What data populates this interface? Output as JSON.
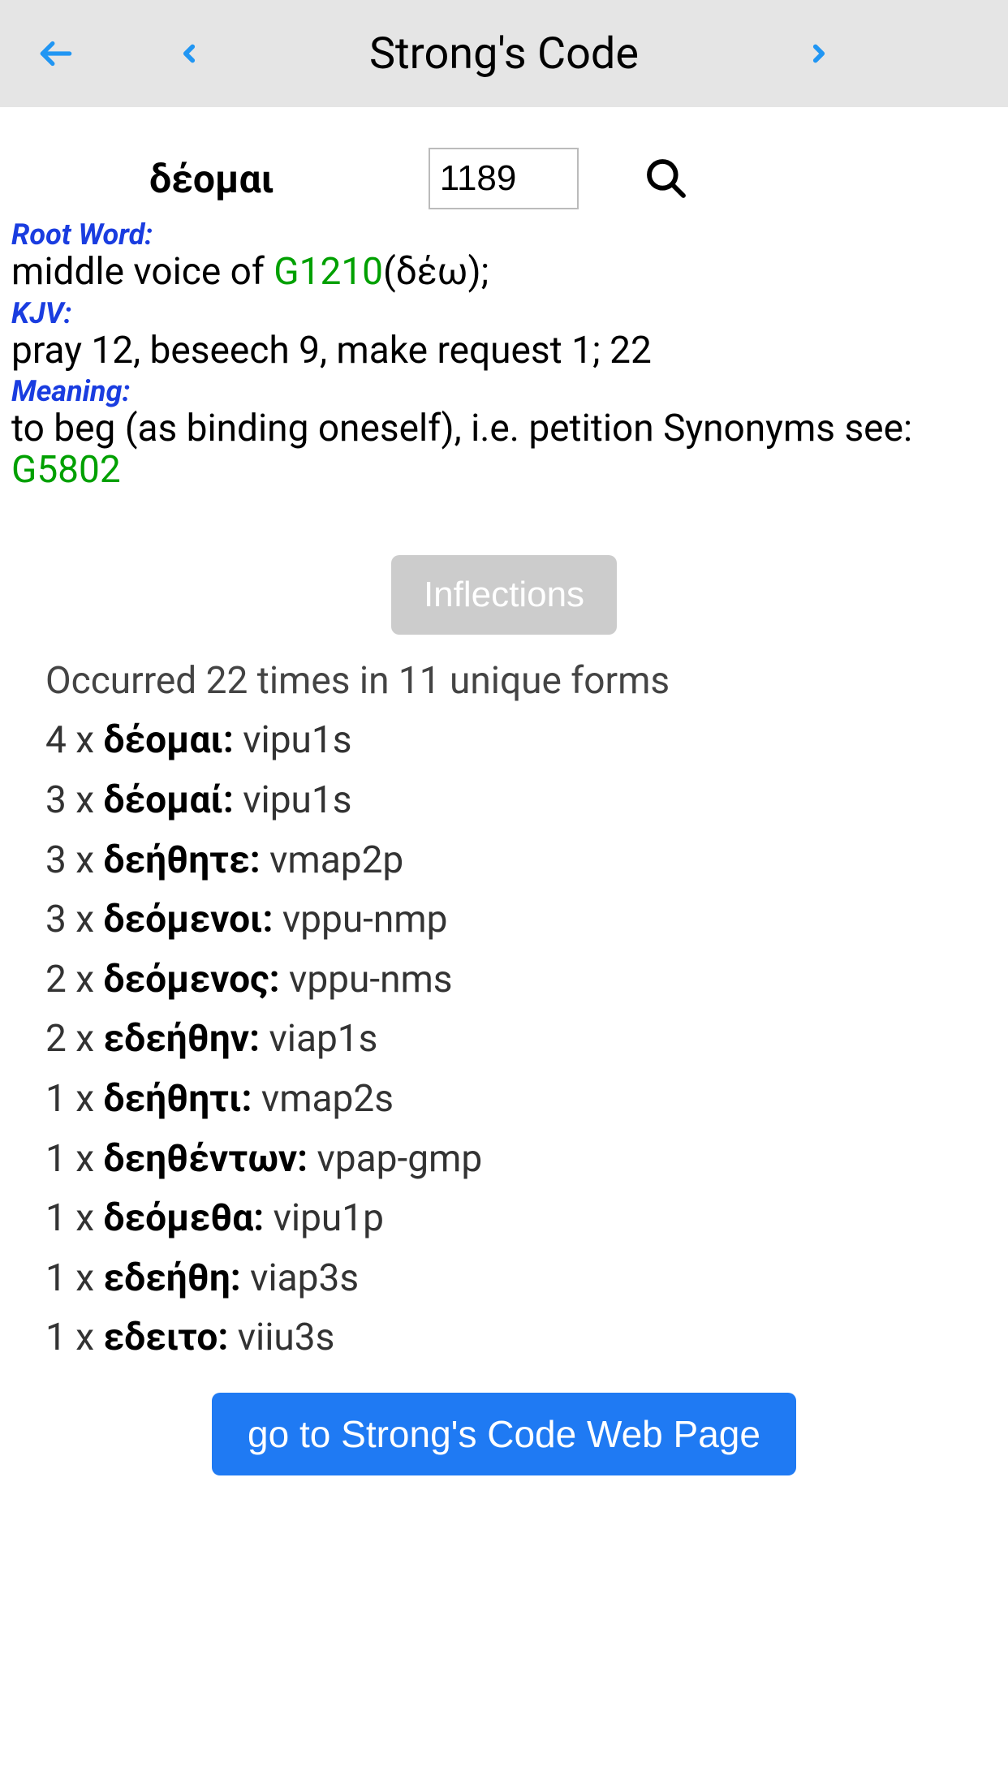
{
  "header": {
    "title": "Strong's Code"
  },
  "word": {
    "greek": "δέομαι",
    "code": "1189"
  },
  "root": {
    "label": "Root Word:",
    "text_before": "middle voice of ",
    "link": "G1210",
    "text_after": "(δέω);"
  },
  "kjv": {
    "label": "KJV:",
    "text": "pray 12, beseech 9, make request 1; 22"
  },
  "meaning": {
    "label": "Meaning:",
    "text_before": "to beg (as binding oneself), i.e. petition Synonyms see: ",
    "link": "G5802"
  },
  "inflections": {
    "button": "Inflections",
    "summary": "Occurred 22 times in 11 unique forms",
    "items": [
      {
        "count": "4 x ",
        "form": "δέομαι:",
        "parse": " vipu1s"
      },
      {
        "count": "3 x ",
        "form": "δέομαί:",
        "parse": " vipu1s"
      },
      {
        "count": "3 x ",
        "form": "δεήθητε:",
        "parse": " vmap2p"
      },
      {
        "count": "3 x ",
        "form": "δεόμενοι:",
        "parse": " vppu-nmp"
      },
      {
        "count": "2 x ",
        "form": "δεόμενος:",
        "parse": " vppu-nms"
      },
      {
        "count": "2 x ",
        "form": "εδεήθην:",
        "parse": " viap1s"
      },
      {
        "count": "1 x ",
        "form": "δεήθητι:",
        "parse": " vmap2s"
      },
      {
        "count": "1 x ",
        "form": "δεηθέντων:",
        "parse": " vpap-gmp"
      },
      {
        "count": "1 x ",
        "form": "δεόμεθα:",
        "parse": " vipu1p"
      },
      {
        "count": "1 x ",
        "form": "εδεήθη:",
        "parse": " viap3s"
      },
      {
        "count": "1 x ",
        "form": "εδειτο:",
        "parse": " viiu3s"
      }
    ]
  },
  "web_button": "go to Strong's Code Web Page"
}
